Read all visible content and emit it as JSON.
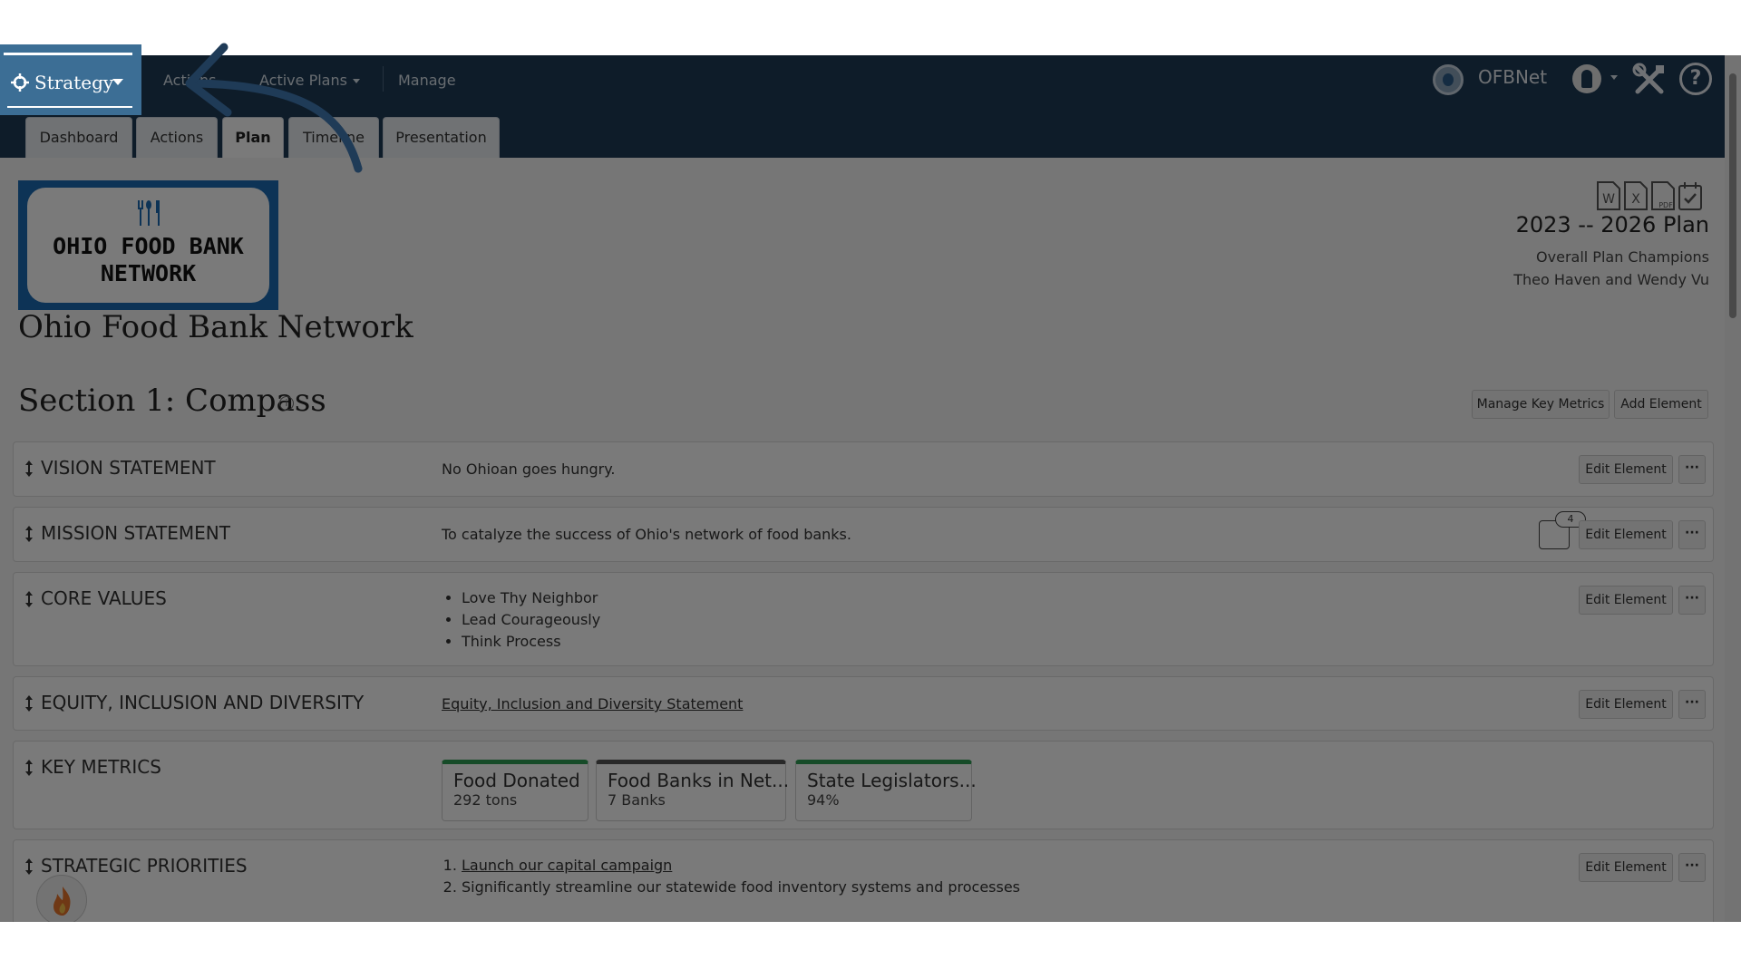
{
  "nav": {
    "app_menu_label": "Strategy",
    "actions_label": "Actions",
    "plans_label": "Active Plans",
    "manage_label": "Manage",
    "org_name": "OFBNet"
  },
  "tabs": [
    {
      "label": "Dashboard"
    },
    {
      "label": "Actions"
    },
    {
      "label": "Plan"
    },
    {
      "label": "Timeline"
    },
    {
      "label": "Presentation"
    }
  ],
  "header": {
    "logo_text_line1": "OHIO FOOD BANK",
    "logo_text_line2": "NETWORK",
    "org_title": "Ohio Food Bank Network",
    "plan_title": "2023 -- 2026 Plan",
    "champions_label": "Overall Plan Champions",
    "champions_names": "Theo Haven and Wendy Vu",
    "export_icons": [
      "word-icon",
      "excel-icon",
      "pdf-icon",
      "calendar-check-icon"
    ]
  },
  "section": {
    "title": "Section 1: Compass",
    "manage_metrics_label": "Manage Key Metrics",
    "add_element_label": "Add Element"
  },
  "rows": {
    "vision": {
      "label": "VISION STATEMENT",
      "text": "No Ohioan goes hungry.",
      "edit": "Edit Element",
      "more": "···"
    },
    "mission": {
      "label": "MISSION STATEMENT",
      "text": "To catalyze the success of Ohio's network of food banks.",
      "comment_count": "4",
      "edit": "Edit Element",
      "more": "···"
    },
    "core": {
      "label": "CORE VALUES",
      "items": [
        "Love Thy Neighbor",
        "Lead Courageously",
        "Think Process"
      ],
      "edit": "Edit Element",
      "more": "···"
    },
    "equity": {
      "label": "EQUITY, INCLUSION AND DIVERSITY",
      "link": "Equity, Inclusion and Diversity Statement",
      "edit": "Edit Element",
      "more": "···"
    },
    "metrics": {
      "label": "KEY METRICS",
      "items": [
        {
          "name": "Food Donated",
          "value": "292 tons",
          "color": "#2e9e54"
        },
        {
          "name": "Food Banks in Net...",
          "value": "7 Banks",
          "color": "#555555"
        },
        {
          "name": "State Legislators...",
          "value": "94%",
          "color": "#2e9e54"
        }
      ]
    },
    "priorities": {
      "label": "STRATEGIC PRIORITIES",
      "items": [
        "Launch our capital campaign",
        "Significantly streamline our statewide food inventory systems and processes"
      ],
      "edit": "Edit Element",
      "more": "···"
    }
  },
  "colors": {
    "nav_bg": "#1f3b57",
    "strategy_highlight": "#3c6e95",
    "logo_blue": "#1d6cb5",
    "metric_green": "#2e9e54"
  }
}
